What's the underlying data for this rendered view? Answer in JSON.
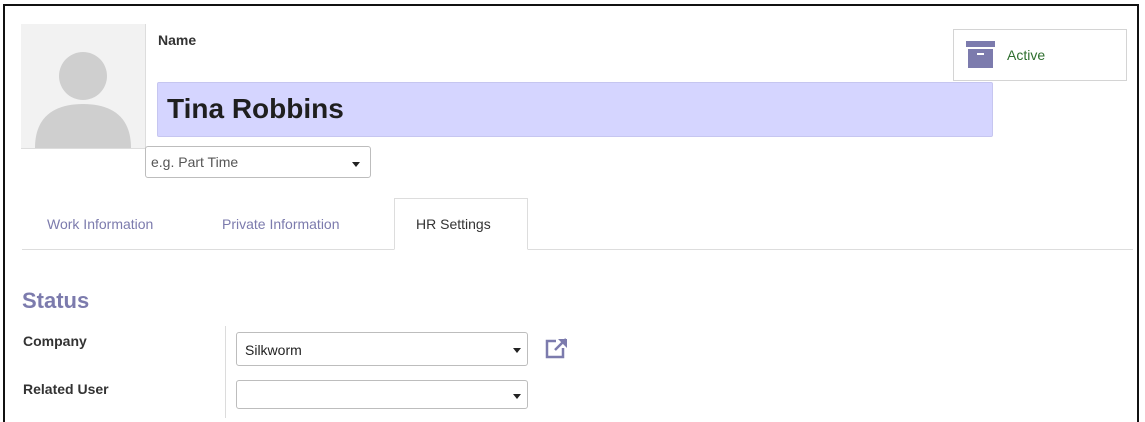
{
  "header": {
    "name_label": "Name",
    "employee_name": "Tina Robbins",
    "category_placeholder": "e.g. Part Time",
    "active_button_label": "Active",
    "avatar_icon": "person-silhouette-icon",
    "archive_icon": "archive-box-icon"
  },
  "tabs": [
    {
      "label": "Work Information"
    },
    {
      "label": "Private Information"
    },
    {
      "label": "HR Settings",
      "active": true
    }
  ],
  "status_section": {
    "title": "Status",
    "fields": [
      {
        "label": "Company",
        "value": "Silkworm",
        "icon": "external-link-icon"
      },
      {
        "label": "Related User",
        "value": ""
      }
    ]
  },
  "colors": {
    "accent": "#7c7bad",
    "name_field_bg": "#d5d5ff",
    "active_text": "#2f6f2f"
  }
}
